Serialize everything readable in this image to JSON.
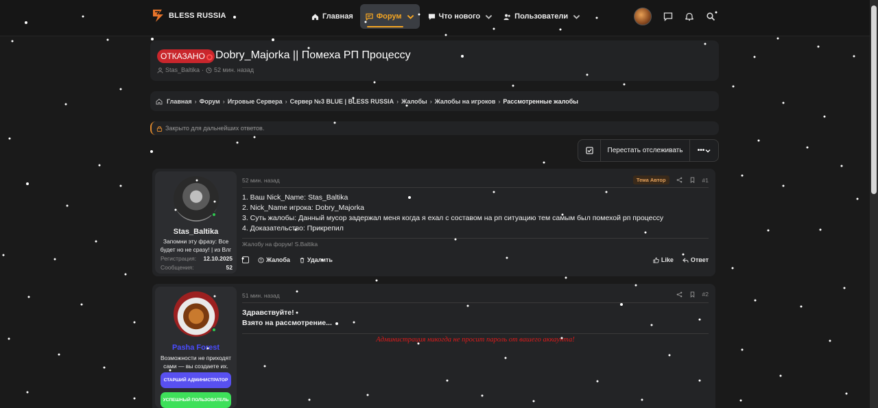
{
  "header": {
    "logo_text": "BLESS RUSSIA",
    "nav": [
      {
        "label": "Главная",
        "icon": "home-icon"
      },
      {
        "label": "Форум",
        "icon": "chat-icon",
        "active": true
      },
      {
        "label": "Что нового",
        "icon": "comment-icon"
      },
      {
        "label": "Пользователи",
        "icon": "users-icon"
      }
    ]
  },
  "thread": {
    "status": "ОТКАЗАНО",
    "title": "Dobry_Majorka || Помеха РП Процессу",
    "author": "Stas_Baltika",
    "time": "52 мин. назад"
  },
  "breadcrumbs": [
    "Главная",
    "Форум",
    "Игровые Сервера",
    "Сервер №3 BLUE | BLESS RUSSIA",
    "Жалобы",
    "Жалобы на игроков",
    "Рассмотренные жалобы"
  ],
  "locked_notice": "Закрыто для дальнейших ответов.",
  "watch_button": "Перестать отслеживать",
  "more_button": "•••",
  "posts": [
    {
      "author": {
        "name": "Stas_Baltika",
        "title": "Запомни эту фразу: Все будет но не сразу! | из Влг",
        "reg_label": "Регистрация:",
        "reg_value": "12.10.2025",
        "msg_label": "Сообщения:",
        "msg_value": "52"
      },
      "time": "52 мин. назад",
      "tag": "Тема Автор",
      "number": "#1",
      "lines": [
        "1. Ваш Nick_Name: Stas_Baltika",
        "2. Nick_Name игрока: Dobry_Majorka",
        "3. Суть жалобы: Данный мусор задержал меня когда я ехал с составом на рп ситуацию тем самым был помехой рп процессу",
        "4. Доказательство: Прикрепил"
      ],
      "signature": "Жалобу на форум! S.Baltika",
      "actions": {
        "report": "Жалоба",
        "delete": "Удалить",
        "like": "Like",
        "reply": "Ответ"
      }
    },
    {
      "author": {
        "name": "Pasha Forest",
        "title": "Возможности не приходят сами — вы создаете их.",
        "badge1": "СТАРШИЙ АДМИНИСТРАТОР",
        "badge2": "УСПЕШНЫЙ ПОЛЬЗОВАТЕЛЬ"
      },
      "time": "51 мин. назад",
      "number": "#2",
      "lines": [
        "Здравствуйте!",
        "Взято на рассмотрение..."
      ],
      "note": "Администрация никогда не просит пароль от вашего аккаунта!"
    }
  ],
  "colors": {
    "accent": "#f5a623",
    "refused": "#c9262c",
    "admin_note": "#e01b1b",
    "admin_name": "#4a4cff"
  }
}
